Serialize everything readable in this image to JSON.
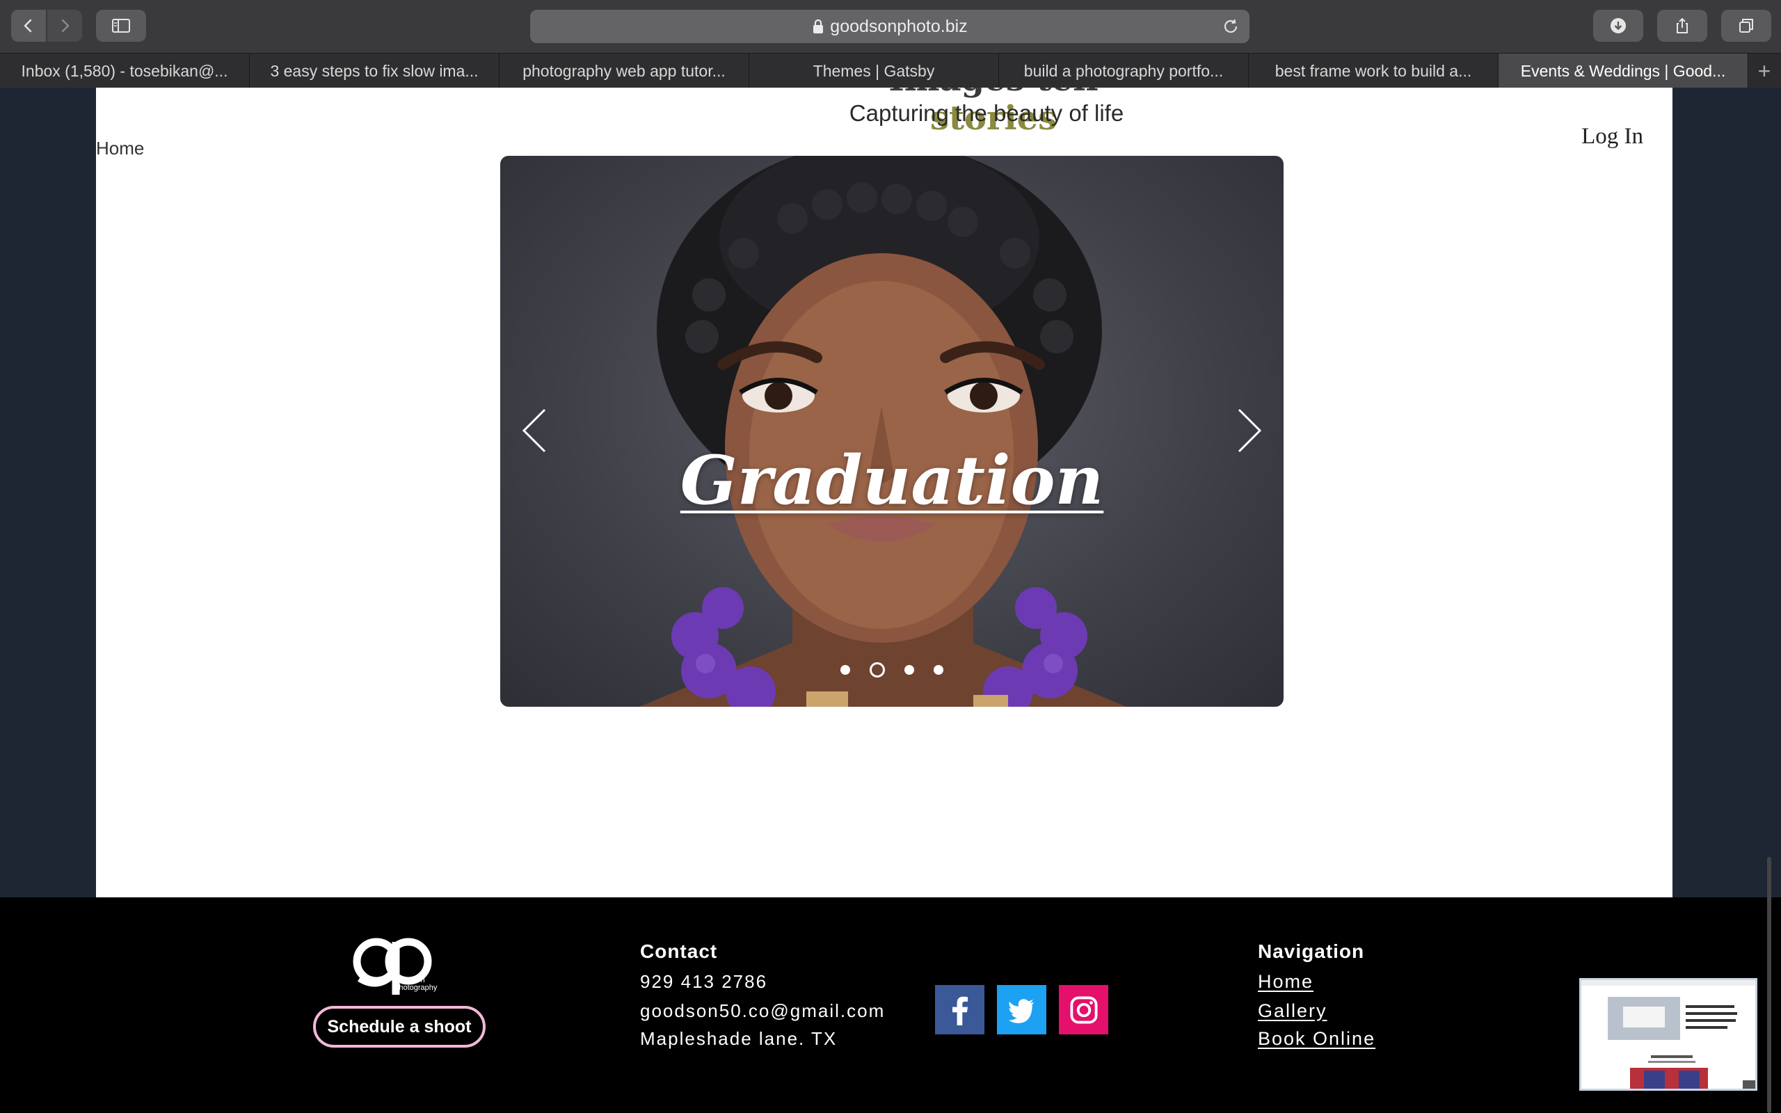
{
  "browser": {
    "url": "goodsonphoto.biz",
    "tabs": [
      {
        "label": "Inbox (1,580) - tosebikan@..."
      },
      {
        "label": "3 easy steps to fix slow ima..."
      },
      {
        "label": "photography web app tutor..."
      },
      {
        "label": "Themes | Gatsby"
      },
      {
        "label": "build a photography portfo..."
      },
      {
        "label": "best frame work to build a..."
      },
      {
        "label": "Events & Weddings | Good..."
      }
    ],
    "active_tab": 6,
    "new_tab_label": "+"
  },
  "header": {
    "logo_part1": "Images tell",
    "logo_part2": "stories",
    "tagline": "Capturing the beauty of life",
    "nav_home": "Home",
    "login": "Log In"
  },
  "slider": {
    "title": "Graduation",
    "dot_count": 4,
    "active_dot": 1
  },
  "footer": {
    "logo_text_line1": "Goodson",
    "logo_text_line2": "Photography",
    "schedule_button": "Schedule a shoot",
    "contact": {
      "title": "Contact",
      "phone": "929 413 2786",
      "email": "goodson50.co@gmail.com",
      "address": "Mapleshade lane. TX"
    },
    "social": [
      {
        "icon": "facebook-icon",
        "color": "#3b5998"
      },
      {
        "icon": "twitter-icon",
        "color": "#1da1f2"
      },
      {
        "icon": "instagram-icon",
        "color": "#e4106b"
      }
    ],
    "navigation": {
      "title": "Navigation",
      "links": [
        "Home",
        "Gallery",
        "Book Online"
      ]
    }
  },
  "colors": {
    "page_bg": "#1e2634",
    "footer_bg": "#000000",
    "schedule_border": "#f2b8d8"
  }
}
